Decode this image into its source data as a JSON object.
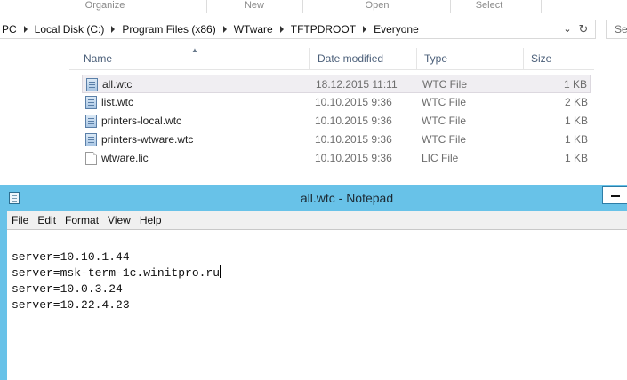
{
  "explorer": {
    "ribbon_groups": [
      "Organize",
      "New",
      "Open",
      "Select"
    ],
    "breadcrumb": [
      "PC",
      "Local Disk (C:)",
      "Program Files (x86)",
      "WTware",
      "TFTPDROOT",
      "Everyone"
    ],
    "search_placeholder": "Sea",
    "columns": {
      "name": "Name",
      "date": "Date modified",
      "type": "Type",
      "size": "Size"
    },
    "files": [
      {
        "name": "all.wtc",
        "date": "18.12.2015 11:11",
        "type": "WTC File",
        "size": "1 KB",
        "icon": "wtc-file-icon",
        "selected": true
      },
      {
        "name": "list.wtc",
        "date": "10.10.2015 9:36",
        "type": "WTC File",
        "size": "2 KB",
        "icon": "wtc-file-icon",
        "selected": false
      },
      {
        "name": "printers-local.wtc",
        "date": "10.10.2015 9:36",
        "type": "WTC File",
        "size": "1 KB",
        "icon": "wtc-file-icon",
        "selected": false
      },
      {
        "name": "printers-wtware.wtc",
        "date": "10.10.2015 9:36",
        "type": "WTC File",
        "size": "1 KB",
        "icon": "wtc-file-icon",
        "selected": false
      },
      {
        "name": "wtware.lic",
        "date": "10.10.2015 9:36",
        "type": "LIC File",
        "size": "1 KB",
        "icon": "lic-file-icon",
        "selected": false
      }
    ]
  },
  "notepad": {
    "title": "all.wtc - Notepad",
    "menu": [
      "File",
      "Edit",
      "Format",
      "View",
      "Help"
    ],
    "lines": [
      "server=10.10.1.44",
      "server=msk-term-1c.winitpro.ru",
      "server=10.0.3.24",
      "server=10.22.4.23"
    ],
    "caret_line": 1
  },
  "colors": {
    "window_frame": "#68c2e8",
    "selection": "#f0eef2",
    "header_text": "#4c607a"
  }
}
